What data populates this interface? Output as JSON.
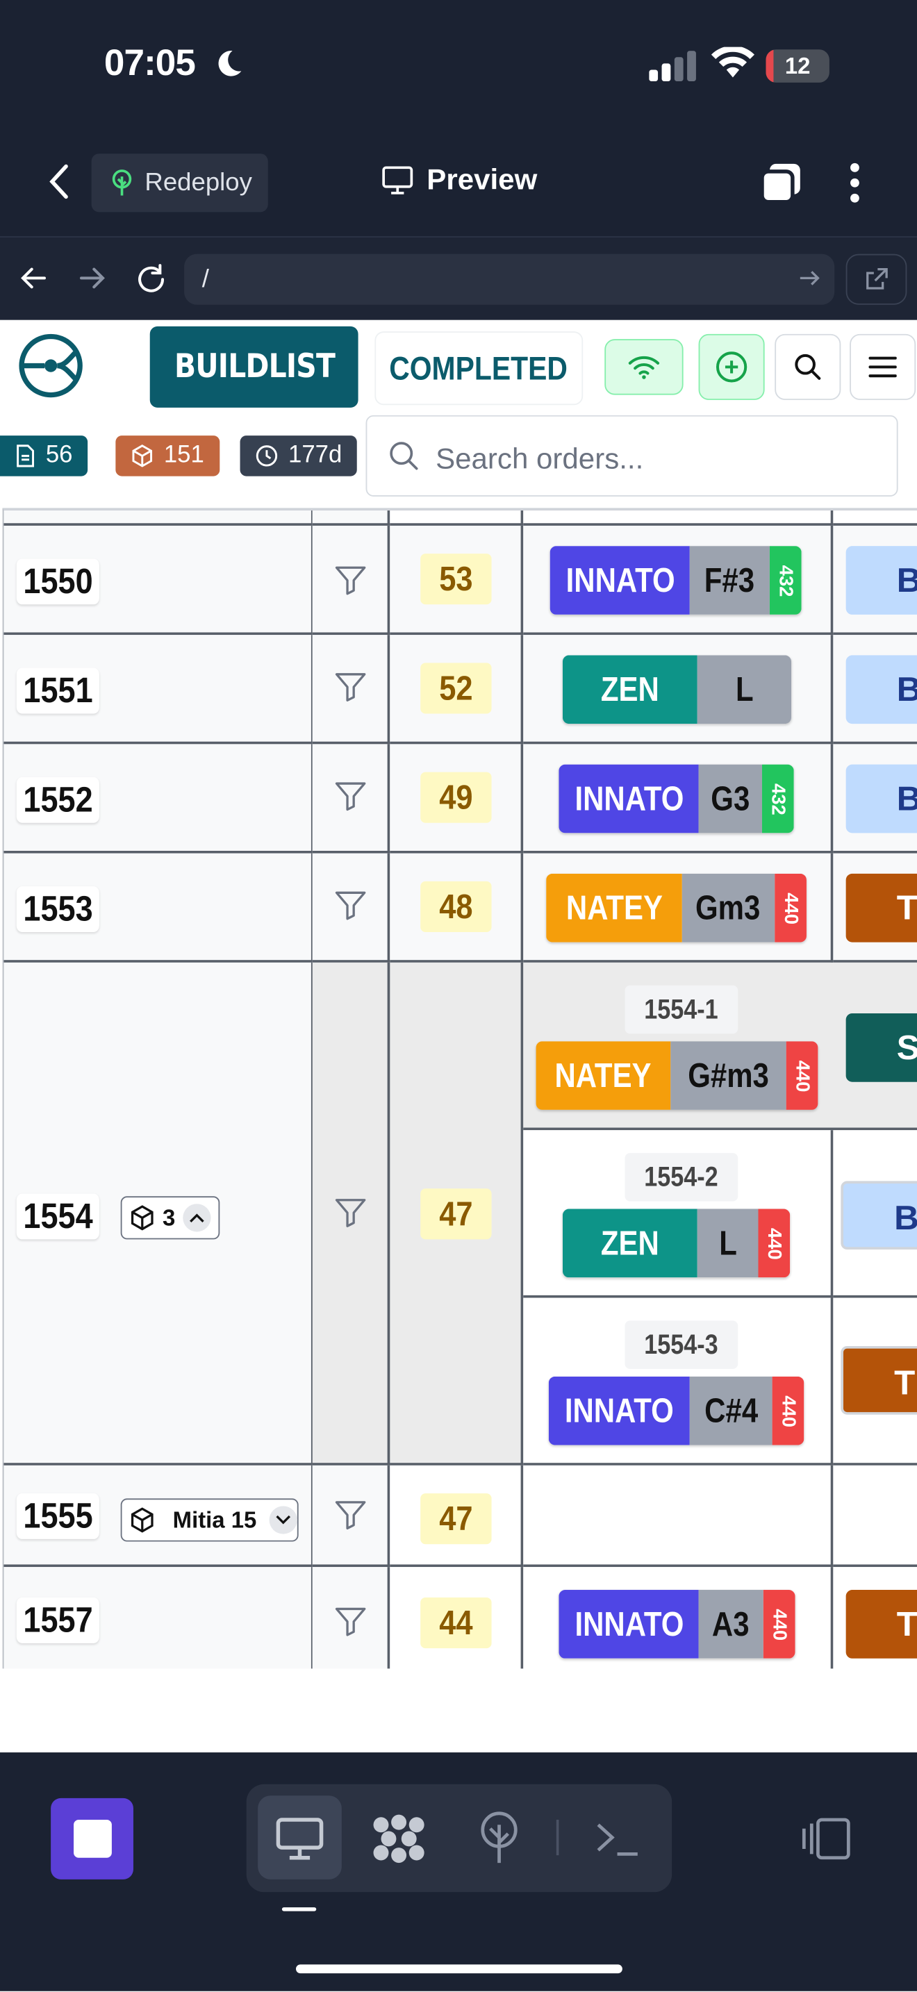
{
  "status": {
    "time": "07:05",
    "battery": "12",
    "battery_level": 0.12
  },
  "topbar": {
    "redeploy_label": "Redeploy",
    "preview_label": "Preview"
  },
  "browser": {
    "url": "/"
  },
  "appbar": {
    "buildlist_label": "BUILDLIST",
    "completed_label": "COMPLETED"
  },
  "stats": {
    "orders": "56",
    "items": "151",
    "days": "177d"
  },
  "search": {
    "placeholder": "Search orders..."
  },
  "rows": {
    "r1550": {
      "id": "1550",
      "count": "53",
      "model": "INNATO",
      "note": "F#3",
      "hz": "432"
    },
    "r1551": {
      "id": "1551",
      "count": "52",
      "model": "ZEN",
      "note": "L"
    },
    "r1552": {
      "id": "1552",
      "count": "49",
      "model": "INNATO",
      "note": "G3",
      "hz": "432"
    },
    "r1553": {
      "id": "1553",
      "count": "48",
      "model": "NATEY",
      "note": "Gm3",
      "hz": "440"
    },
    "r1554": {
      "id": "1554",
      "count": "47",
      "chip_count": "3",
      "items": [
        {
          "sub_id": "1554-1",
          "model": "NATEY",
          "note": "G#m3",
          "hz": "440"
        },
        {
          "sub_id": "1554-2",
          "model": "ZEN",
          "note": "L",
          "hz": "440"
        },
        {
          "sub_id": "1554-3",
          "model": "INNATO",
          "note": "C#4",
          "hz": "440"
        }
      ]
    },
    "r1555": {
      "id": "1555",
      "count": "47",
      "chip_label": "Mitia 15"
    },
    "r1557": {
      "id": "1557",
      "count": "44",
      "model": "INNATO",
      "note": "A3",
      "hz": "440"
    }
  },
  "status_tags": {
    "b": "B",
    "te": "TE",
    "se": "SE"
  },
  "colors": {
    "innato": "#4f46e5",
    "zen": "#0d9488",
    "natey": "#f59e0b",
    "hz432": "#22c55e",
    "hz440": "#ef4444",
    "tag_b": "#bfdbfe",
    "tag_te": "#b45309",
    "tag_se": "#115e59",
    "primary": "#0b5b6b"
  }
}
